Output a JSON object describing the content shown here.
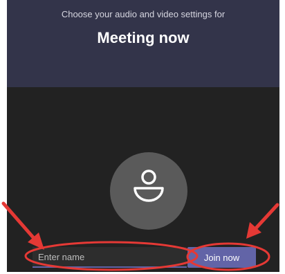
{
  "header": {
    "subtitle": "Choose your audio and video settings for",
    "title": "Meeting now"
  },
  "avatar": {
    "icon": "person-icon"
  },
  "name_field": {
    "placeholder": "Enter name",
    "value": ""
  },
  "join_button": {
    "label": "Join now"
  },
  "annotations": {
    "color": "#e53935",
    "marks": [
      "arrow-icon",
      "ellipse-highlight"
    ]
  },
  "colors": {
    "accent": "#6264a7",
    "header_bg": "#33344a",
    "stage_bg": "#222222"
  }
}
